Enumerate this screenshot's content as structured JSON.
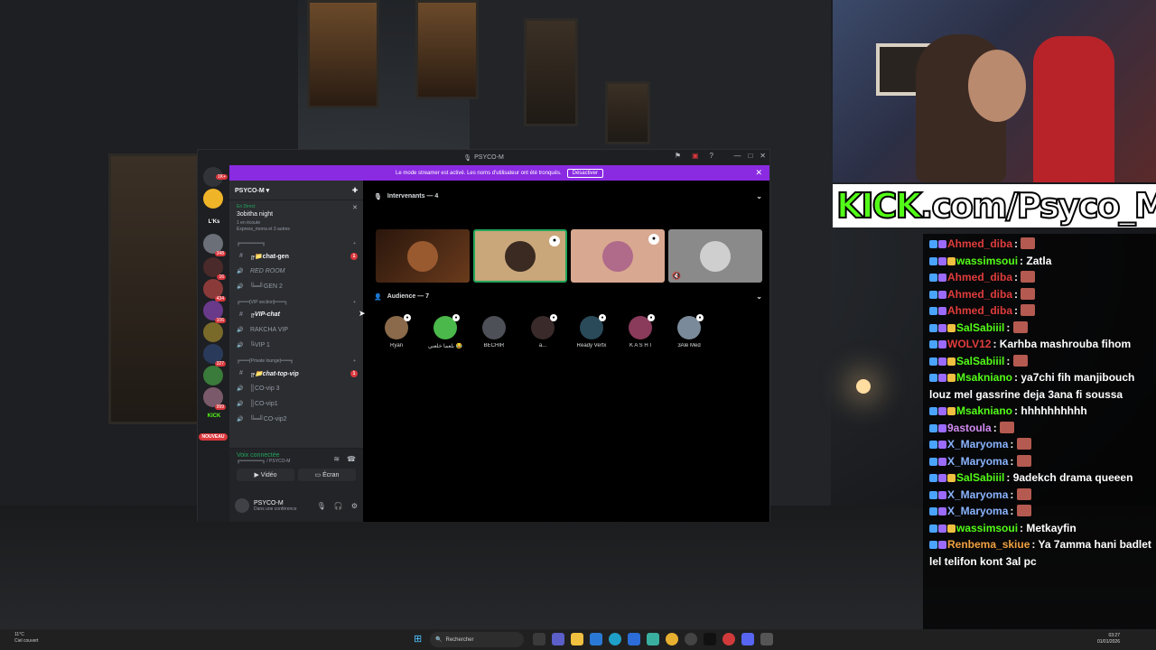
{
  "discord": {
    "window_title": "PSYCO-M",
    "banner": {
      "text": "Le mode streamer est activé. Les noms d'utilisateur ont été tronqués.",
      "button": "Désactiver"
    },
    "server_name": "PSYCO-M",
    "server_labels": {
      "lks": "L'Ks",
      "kick": "KICK",
      "new": "NOUVEAU"
    },
    "server_badges": [
      "16",
      "434",
      "106",
      "348",
      "327",
      "999"
    ],
    "live": {
      "status": "En Direct",
      "title": "3obitha night",
      "meta1": "1 en écoute",
      "meta2": "Express_morra et 3 autres"
    },
    "categories": [
      "╔═══════╗",
      "╔═══[VIP section]═══╗",
      "╔═══[Private lounge]═══╗"
    ],
    "channels": [
      {
        "name": "╔📁chat-gen",
        "unread": "1"
      },
      {
        "name": "RED ROOM"
      },
      {
        "name": "╚═╝GEN 2"
      },
      {
        "name": "╔VIP-chat"
      },
      {
        "name": "RAKCHA VIP"
      },
      {
        "name": "╚VIP 1"
      },
      {
        "name": "╔📁chat-top-vip",
        "unread": "1"
      },
      {
        "name": "║CO-vip 3"
      },
      {
        "name": "║CO-vip1"
      },
      {
        "name": "╚═╝CO-vip2"
      }
    ],
    "voice": {
      "status": "Voix connectée",
      "channel": "╔═══════╗ / PSYCO-M",
      "video": "Vidéo",
      "screen": "Écran"
    },
    "user": {
      "name": "PSYCO-M",
      "status": "Dans une conférence"
    },
    "speakers_header": "Intervenants — 4",
    "audience_header": "Audience — 7",
    "audience": [
      "Ryan",
      "بلعما خلعني 😂",
      "BECHIR",
      "a...",
      "Ready Vertx",
      "K A S H I",
      "3Alé Med"
    ]
  },
  "kick_banner": {
    "brand": "KICK",
    "rest": ".com/Psyco_M"
  },
  "chat": [
    {
      "user": "Ahmed_diba",
      "color": "#e03c3c",
      "text": "",
      "emote": true
    },
    {
      "user": "wassimsoui",
      "color": "#53fc18",
      "text": "Zatla",
      "emote": false
    },
    {
      "user": "Ahmed_diba",
      "color": "#e03c3c",
      "text": "",
      "emote": true
    },
    {
      "user": "Ahmed_diba",
      "color": "#e03c3c",
      "text": "",
      "emote": true
    },
    {
      "user": "Ahmed_diba",
      "color": "#e03c3c",
      "text": "",
      "emote": true
    },
    {
      "user": "SalSabiiil",
      "color": "#53fc18",
      "text": "",
      "emote": true
    },
    {
      "user": "WOLV12",
      "color": "#e03c3c",
      "text": "Karhba mashrouba fihom",
      "emote": false
    },
    {
      "user": "SalSabiiil",
      "color": "#53fc18",
      "text": "",
      "emote": true
    },
    {
      "user": "Msakniano",
      "color": "#53fc18",
      "text": "ya7chi fih manjibouch louz mel gassrine deja 3ana fi soussa",
      "emote": false
    },
    {
      "user": "Msakniano",
      "color": "#53fc18",
      "text": "hhhhhhhhhh",
      "emote": false
    },
    {
      "user": "9astoula",
      "color": "#d28cf0",
      "text": "",
      "emote": true
    },
    {
      "user": "X_Maryoma",
      "color": "#8ab4ff",
      "text": "",
      "emote": true
    },
    {
      "user": "X_Maryoma",
      "color": "#8ab4ff",
      "text": "",
      "emote": true
    },
    {
      "user": "SalSabiiil",
      "color": "#53fc18",
      "text": "9adekch drama queeen",
      "emote": false
    },
    {
      "user": "X_Maryoma",
      "color": "#8ab4ff",
      "text": "",
      "emote": true
    },
    {
      "user": "X_Maryoma",
      "color": "#8ab4ff",
      "text": "",
      "emote": true
    },
    {
      "user": "wassimsoui",
      "color": "#53fc18",
      "text": "Metkayfin",
      "emote": false
    },
    {
      "user": "Renbema_skiue",
      "color": "#f0a040",
      "text": "Ya 7amma hani badlet lel telifon kont 3al pc",
      "emote": false
    }
  ],
  "taskbar": {
    "weather_temp": "11°C",
    "weather_desc": "Ciel couvert",
    "search_placeholder": "Rechercher",
    "time": "03:27",
    "date": "01/01/2026"
  }
}
